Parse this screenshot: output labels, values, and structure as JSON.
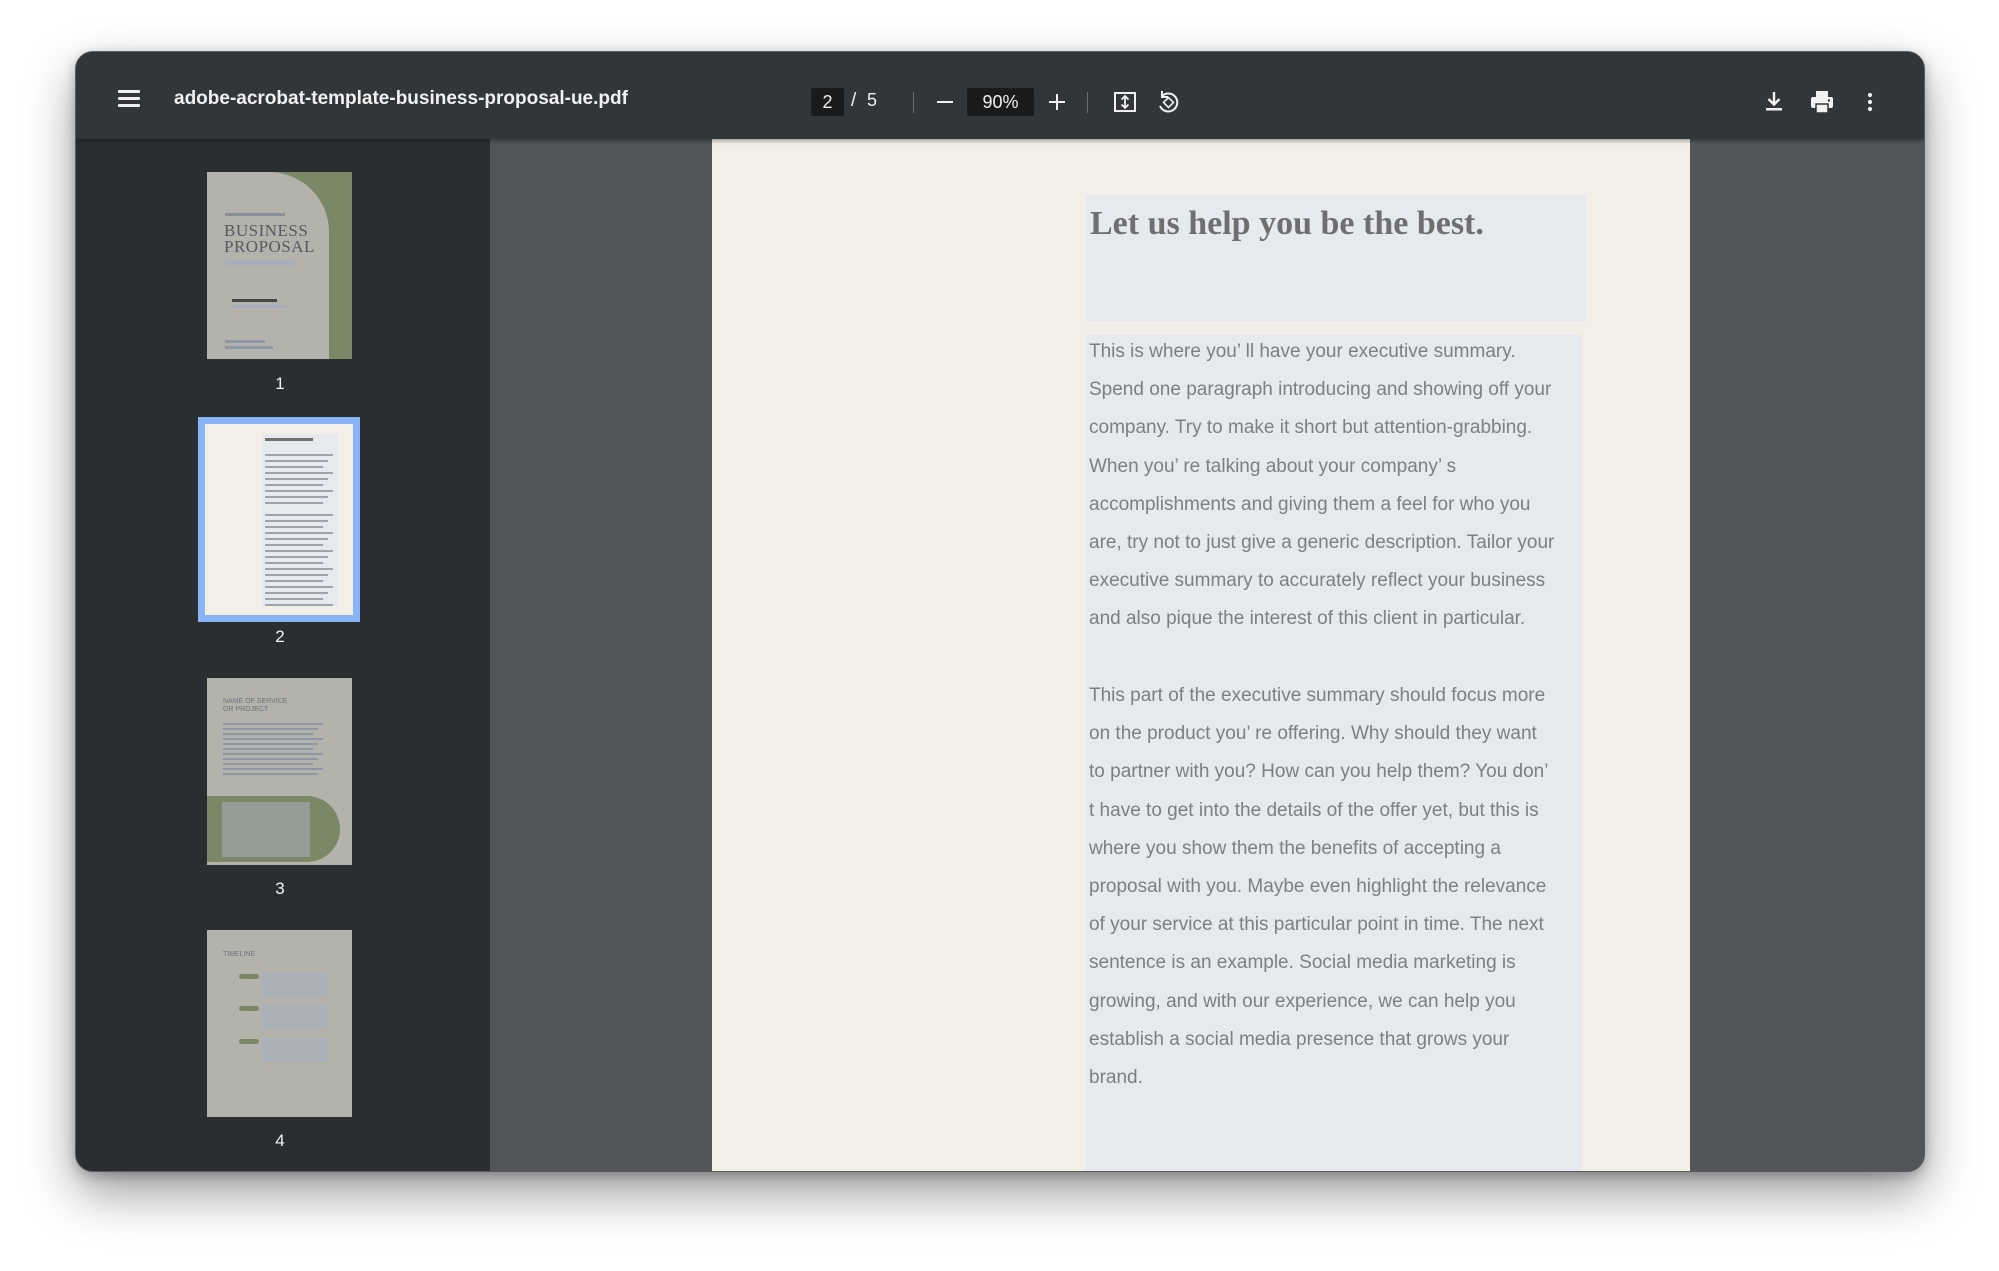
{
  "toolbar": {
    "title": "adobe-acrobat-template-business-proposal-ue.pdf",
    "current_page": "2",
    "page_separator": "/",
    "total_pages": "5",
    "zoom": "90%"
  },
  "icons": {
    "menu": "hamburger-menu-icon",
    "zoom_out": "minus-icon",
    "zoom_in": "plus-icon",
    "fit": "fit-to-page-icon",
    "rotate": "rotate-counterclockwise-icon",
    "download": "download-icon",
    "print": "print-icon",
    "more": "more-vertical-icon"
  },
  "thumbnails": [
    {
      "label": "1",
      "cover_title_1": "BUSINESS",
      "cover_title_2": "PROPOSAL"
    },
    {
      "label": "2",
      "selected": true
    },
    {
      "label": "3",
      "heading_1": "NAME OF SERVICE",
      "heading_2": "OR PROJECT"
    },
    {
      "label": "4",
      "heading": "TIMELINE"
    }
  ],
  "page": {
    "heading": "Let us help you be the best.",
    "paragraph1": [
      "This is where you’ ll have your executive summary.",
      "Spend one paragraph introducing and showing off your",
      "company. Try to make it short but attention-grabbing.",
      "When you’ re talking about your company’ s",
      "accomplishments and giving them a feel for who you",
      "are, try not to just give a generic description. Tailor your",
      "executive summary to accurately reflect your business",
      "and also pique the interest of this client in particular."
    ],
    "paragraph2": [
      "This part of the executive summary should focus more",
      "on the product you’ re offering. Why should they want",
      "to partner with you? How can you help them? You don’",
      "t have to get into the details of the offer yet, but this is",
      "where you show them the benefits of accepting a",
      "proposal with you. Maybe even highlight the relevance",
      "of your service at this particular point in time. The next",
      "sentence is an example. Social media marketing is",
      "growing, and with our experience, we can help you",
      "establish a social media presence that grows your",
      "brand."
    ]
  },
  "colors": {
    "toolbar_bg": "#323639",
    "sidebar_bg": "#2b2e31",
    "viewer_bg": "#525659",
    "selection": "#8ab4f8",
    "page_bg": "#f2efe8",
    "text_box_bg": "#e6e9ee",
    "cover_green": "#7b8868"
  }
}
